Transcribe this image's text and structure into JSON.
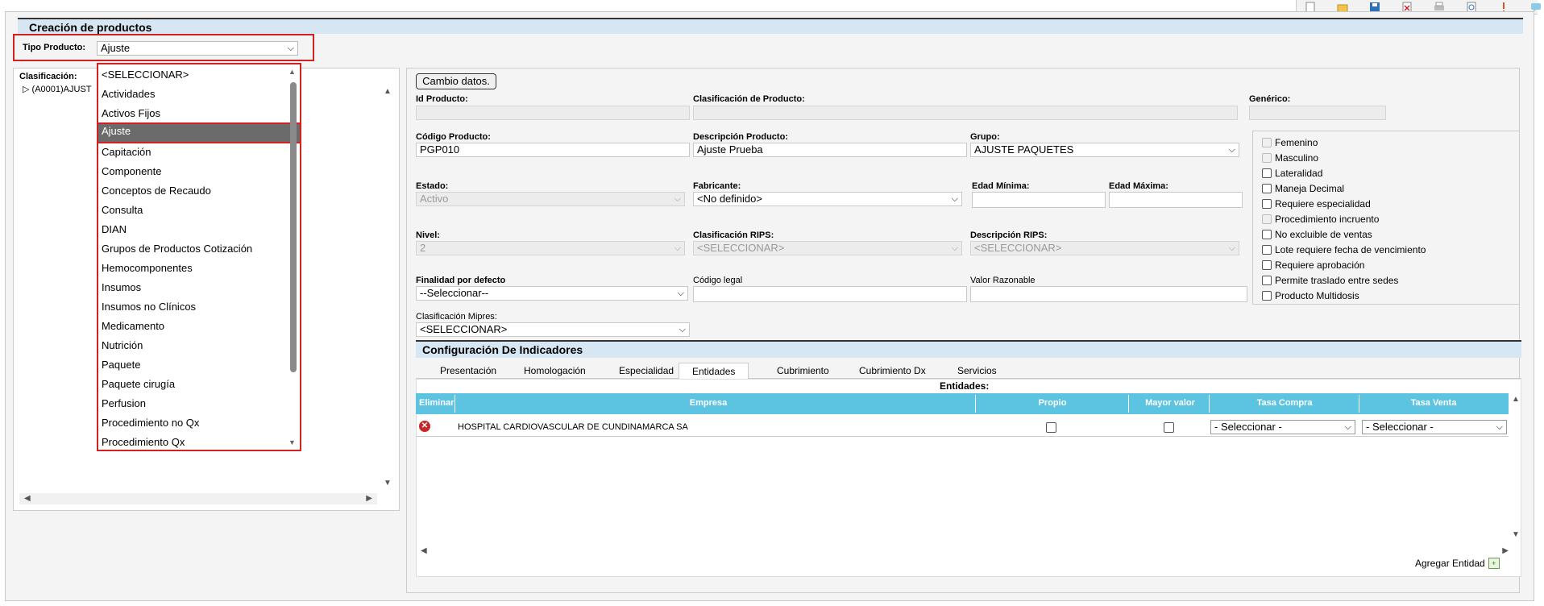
{
  "page": {
    "title": "Creación de productos",
    "tipo_label": "Tipo Producto:",
    "tipo_value": "Ajuste"
  },
  "tree": {
    "label": "Clasificación:",
    "item": "(A0001)AJUST"
  },
  "dropdown": {
    "options": [
      "<SELECCIONAR>",
      "Actividades",
      "Activos Fijos",
      "Ajuste",
      "Capitación",
      "Componente",
      "Conceptos de Recaudo",
      "Consulta",
      "DIAN",
      "Grupos de Productos Cotización",
      "Hemocomponentes",
      "Insumos",
      "Insumos no Clínicos",
      "Medicamento",
      "Nutrición",
      "Paquete",
      "Paquete cirugía",
      "Perfusion",
      "Procedimiento no Qx",
      "Procedimiento Qx"
    ],
    "selected": "Ajuste"
  },
  "form": {
    "cambio_button": "Cambio datos.",
    "id_label": "Id Producto:",
    "clasif_label": "Clasificación de Producto:",
    "generico_label": "Genérico:",
    "codigo_label": "Código Producto:",
    "codigo_value": "PGP010",
    "descripcion_label": "Descripción Producto:",
    "descripcion_value": "Ajuste Prueba",
    "grupo_label": "Grupo:",
    "grupo_value": "AJUSTE PAQUETES",
    "estado_label": "Estado:",
    "estado_value": "Activo",
    "fabricante_label": "Fabricante:",
    "fabricante_value": "<No definido>",
    "edad_min_label": "Edad Mínima:",
    "edad_max_label": "Edad Máxima:",
    "nivel_label": "Nivel:",
    "nivel_value": "2",
    "clasif_rips_label": "Clasificación RIPS:",
    "clasif_rips_value": "<SELECCIONAR>",
    "desc_rips_label": "Descripción RIPS:",
    "desc_rips_value": "<SELECCIONAR>",
    "finalidad_label": "Finalidad por defecto",
    "finalidad_value": "--Seleccionar--",
    "codigo_legal_label": "Código legal",
    "valor_razonable_label": "Valor Razonable",
    "mipres_label": "Clasificación Mipres:",
    "mipres_value": "<SELECCIONAR>"
  },
  "checkboxes": [
    {
      "label": "Femenino",
      "disabled": true
    },
    {
      "label": "Masculino",
      "disabled": true
    },
    {
      "label": "Lateralidad",
      "disabled": false
    },
    {
      "label": "Maneja Decimal",
      "disabled": false
    },
    {
      "label": "Requiere especialidad",
      "disabled": false
    },
    {
      "label": "Procedimiento incruento",
      "disabled": true
    },
    {
      "label": "No excluible de ventas",
      "disabled": false
    },
    {
      "label": "Lote requiere fecha de vencimiento",
      "disabled": false
    },
    {
      "label": "Requiere aprobación",
      "disabled": false
    },
    {
      "label": "Permite traslado entre sedes",
      "disabled": false
    },
    {
      "label": "Producto Multidosis",
      "disabled": false
    }
  ],
  "indicadores": {
    "title": "Configuración De Indicadores",
    "tabs": [
      "Presentación",
      "Homologación",
      "Especialidad",
      "Entidades",
      "Cubrimiento",
      "Cubrimiento Dx",
      "Servicios"
    ],
    "active_tab": "Entidades",
    "entidades_title": "Entidades:",
    "columns": [
      "Eliminar",
      "Empresa",
      "Propio",
      "Mayor valor",
      "Tasa Compra",
      "Tasa Venta"
    ],
    "row": {
      "empresa": "HOSPITAL CARDIOVASCULAR DE CUNDINAMARCA SA",
      "tasa_compra": "- Seleccionar -",
      "tasa_venta": "- Seleccionar -"
    },
    "agregar": "Agregar Entidad"
  }
}
